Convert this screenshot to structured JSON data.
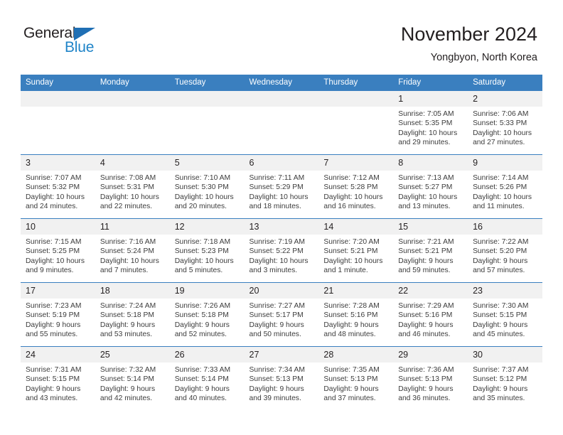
{
  "logo": {
    "word1": "General",
    "word2": "Blue",
    "triangle_color": "#1f6fb4",
    "word2_color": "#1f84c8"
  },
  "header": {
    "title": "November 2024",
    "subtitle": "Yongbyon, North Korea"
  },
  "theme": {
    "header_blue": "#3a7fbf",
    "daynum_gray": "#f1f1f1",
    "text": "#231f20"
  },
  "calendar": {
    "weekday_headers": [
      "Sunday",
      "Monday",
      "Tuesday",
      "Wednesday",
      "Thursday",
      "Friday",
      "Saturday"
    ],
    "labels": {
      "sunrise": "Sunrise:",
      "sunset": "Sunset:",
      "daylight": "Daylight:"
    },
    "weeks": [
      [
        {
          "day": "",
          "empty": true
        },
        {
          "day": "",
          "empty": true
        },
        {
          "day": "",
          "empty": true
        },
        {
          "day": "",
          "empty": true
        },
        {
          "day": "",
          "empty": true
        },
        {
          "day": "1",
          "sunrise": "Sunrise: 7:05 AM",
          "sunset": "Sunset: 5:35 PM",
          "daylight": "Daylight: 10 hours and 29 minutes."
        },
        {
          "day": "2",
          "sunrise": "Sunrise: 7:06 AM",
          "sunset": "Sunset: 5:33 PM",
          "daylight": "Daylight: 10 hours and 27 minutes."
        }
      ],
      [
        {
          "day": "3",
          "sunrise": "Sunrise: 7:07 AM",
          "sunset": "Sunset: 5:32 PM",
          "daylight": "Daylight: 10 hours and 24 minutes."
        },
        {
          "day": "4",
          "sunrise": "Sunrise: 7:08 AM",
          "sunset": "Sunset: 5:31 PM",
          "daylight": "Daylight: 10 hours and 22 minutes."
        },
        {
          "day": "5",
          "sunrise": "Sunrise: 7:10 AM",
          "sunset": "Sunset: 5:30 PM",
          "daylight": "Daylight: 10 hours and 20 minutes."
        },
        {
          "day": "6",
          "sunrise": "Sunrise: 7:11 AM",
          "sunset": "Sunset: 5:29 PM",
          "daylight": "Daylight: 10 hours and 18 minutes."
        },
        {
          "day": "7",
          "sunrise": "Sunrise: 7:12 AM",
          "sunset": "Sunset: 5:28 PM",
          "daylight": "Daylight: 10 hours and 16 minutes."
        },
        {
          "day": "8",
          "sunrise": "Sunrise: 7:13 AM",
          "sunset": "Sunset: 5:27 PM",
          "daylight": "Daylight: 10 hours and 13 minutes."
        },
        {
          "day": "9",
          "sunrise": "Sunrise: 7:14 AM",
          "sunset": "Sunset: 5:26 PM",
          "daylight": "Daylight: 10 hours and 11 minutes."
        }
      ],
      [
        {
          "day": "10",
          "sunrise": "Sunrise: 7:15 AM",
          "sunset": "Sunset: 5:25 PM",
          "daylight": "Daylight: 10 hours and 9 minutes."
        },
        {
          "day": "11",
          "sunrise": "Sunrise: 7:16 AM",
          "sunset": "Sunset: 5:24 PM",
          "daylight": "Daylight: 10 hours and 7 minutes."
        },
        {
          "day": "12",
          "sunrise": "Sunrise: 7:18 AM",
          "sunset": "Sunset: 5:23 PM",
          "daylight": "Daylight: 10 hours and 5 minutes."
        },
        {
          "day": "13",
          "sunrise": "Sunrise: 7:19 AM",
          "sunset": "Sunset: 5:22 PM",
          "daylight": "Daylight: 10 hours and 3 minutes."
        },
        {
          "day": "14",
          "sunrise": "Sunrise: 7:20 AM",
          "sunset": "Sunset: 5:21 PM",
          "daylight": "Daylight: 10 hours and 1 minute."
        },
        {
          "day": "15",
          "sunrise": "Sunrise: 7:21 AM",
          "sunset": "Sunset: 5:21 PM",
          "daylight": "Daylight: 9 hours and 59 minutes."
        },
        {
          "day": "16",
          "sunrise": "Sunrise: 7:22 AM",
          "sunset": "Sunset: 5:20 PM",
          "daylight": "Daylight: 9 hours and 57 minutes."
        }
      ],
      [
        {
          "day": "17",
          "sunrise": "Sunrise: 7:23 AM",
          "sunset": "Sunset: 5:19 PM",
          "daylight": "Daylight: 9 hours and 55 minutes."
        },
        {
          "day": "18",
          "sunrise": "Sunrise: 7:24 AM",
          "sunset": "Sunset: 5:18 PM",
          "daylight": "Daylight: 9 hours and 53 minutes."
        },
        {
          "day": "19",
          "sunrise": "Sunrise: 7:26 AM",
          "sunset": "Sunset: 5:18 PM",
          "daylight": "Daylight: 9 hours and 52 minutes."
        },
        {
          "day": "20",
          "sunrise": "Sunrise: 7:27 AM",
          "sunset": "Sunset: 5:17 PM",
          "daylight": "Daylight: 9 hours and 50 minutes."
        },
        {
          "day": "21",
          "sunrise": "Sunrise: 7:28 AM",
          "sunset": "Sunset: 5:16 PM",
          "daylight": "Daylight: 9 hours and 48 minutes."
        },
        {
          "day": "22",
          "sunrise": "Sunrise: 7:29 AM",
          "sunset": "Sunset: 5:16 PM",
          "daylight": "Daylight: 9 hours and 46 minutes."
        },
        {
          "day": "23",
          "sunrise": "Sunrise: 7:30 AM",
          "sunset": "Sunset: 5:15 PM",
          "daylight": "Daylight: 9 hours and 45 minutes."
        }
      ],
      [
        {
          "day": "24",
          "sunrise": "Sunrise: 7:31 AM",
          "sunset": "Sunset: 5:15 PM",
          "daylight": "Daylight: 9 hours and 43 minutes."
        },
        {
          "day": "25",
          "sunrise": "Sunrise: 7:32 AM",
          "sunset": "Sunset: 5:14 PM",
          "daylight": "Daylight: 9 hours and 42 minutes."
        },
        {
          "day": "26",
          "sunrise": "Sunrise: 7:33 AM",
          "sunset": "Sunset: 5:14 PM",
          "daylight": "Daylight: 9 hours and 40 minutes."
        },
        {
          "day": "27",
          "sunrise": "Sunrise: 7:34 AM",
          "sunset": "Sunset: 5:13 PM",
          "daylight": "Daylight: 9 hours and 39 minutes."
        },
        {
          "day": "28",
          "sunrise": "Sunrise: 7:35 AM",
          "sunset": "Sunset: 5:13 PM",
          "daylight": "Daylight: 9 hours and 37 minutes."
        },
        {
          "day": "29",
          "sunrise": "Sunrise: 7:36 AM",
          "sunset": "Sunset: 5:13 PM",
          "daylight": "Daylight: 9 hours and 36 minutes."
        },
        {
          "day": "30",
          "sunrise": "Sunrise: 7:37 AM",
          "sunset": "Sunset: 5:12 PM",
          "daylight": "Daylight: 9 hours and 35 minutes."
        }
      ]
    ]
  }
}
